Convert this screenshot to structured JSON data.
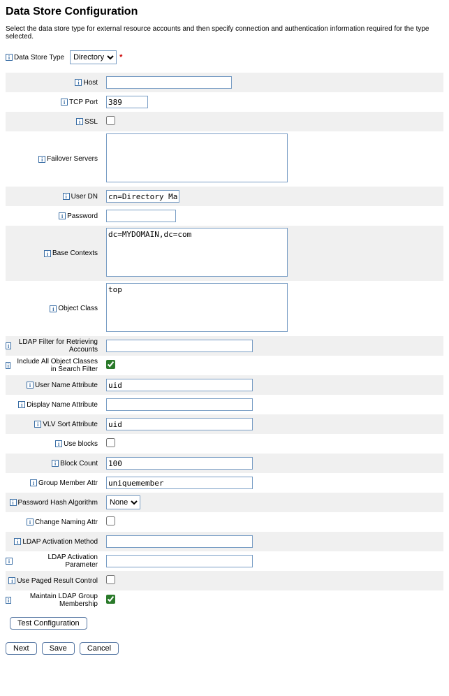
{
  "page": {
    "title": "Data Store Configuration",
    "description": "Select the data store type for external resource accounts and then specify connection and authentication information required for the type selected."
  },
  "dataStoreType": {
    "label": "Data Store Type",
    "selected": "Directory",
    "options": [
      "Directory"
    ]
  },
  "fields": {
    "host": {
      "label": "Host",
      "value": ""
    },
    "tcpPort": {
      "label": "TCP Port",
      "value": "389"
    },
    "ssl": {
      "label": "SSL",
      "checked": false
    },
    "failoverServers": {
      "label": "Failover Servers",
      "value": ""
    },
    "userDn": {
      "label": "User DN",
      "value": "cn=Directory Manager"
    },
    "password": {
      "label": "Password",
      "value": ""
    },
    "baseContexts": {
      "label": "Base Contexts",
      "value": "dc=MYDOMAIN,dc=com"
    },
    "objectClass": {
      "label": "Object Class",
      "value": "top"
    },
    "ldapFilter": {
      "label": "LDAP Filter for Retrieving Accounts",
      "value": ""
    },
    "includeAllObjClasses": {
      "label": "Include All Object Classes in Search Filter",
      "checked": true
    },
    "userNameAttr": {
      "label": "User Name Attribute",
      "value": "uid"
    },
    "displayNameAttr": {
      "label": "Display Name Attribute",
      "value": ""
    },
    "vlvSortAttr": {
      "label": "VLV Sort Attribute",
      "value": "uid"
    },
    "useBlocks": {
      "label": "Use blocks",
      "checked": false
    },
    "blockCount": {
      "label": "Block Count",
      "value": "100"
    },
    "groupMemberAttr": {
      "label": "Group Member Attr",
      "value": "uniquemember"
    },
    "pwdHashAlg": {
      "label": "Password Hash Algorithm",
      "selected": "None",
      "options": [
        "None"
      ]
    },
    "changeNamingAttr": {
      "label": "Change Naming Attr",
      "checked": false
    },
    "ldapActivationMethod": {
      "label": "LDAP Activation Method",
      "value": ""
    },
    "ldapActivationParam": {
      "label": "LDAP Activation Parameter",
      "value": ""
    },
    "usePagedResult": {
      "label": "Use Paged Result Control",
      "checked": false
    },
    "maintainLdapGroup": {
      "label": "Maintain LDAP Group Membership",
      "checked": true
    }
  },
  "buttons": {
    "testConfig": "Test Configuration",
    "next": "Next",
    "save": "Save",
    "cancel": "Cancel"
  }
}
